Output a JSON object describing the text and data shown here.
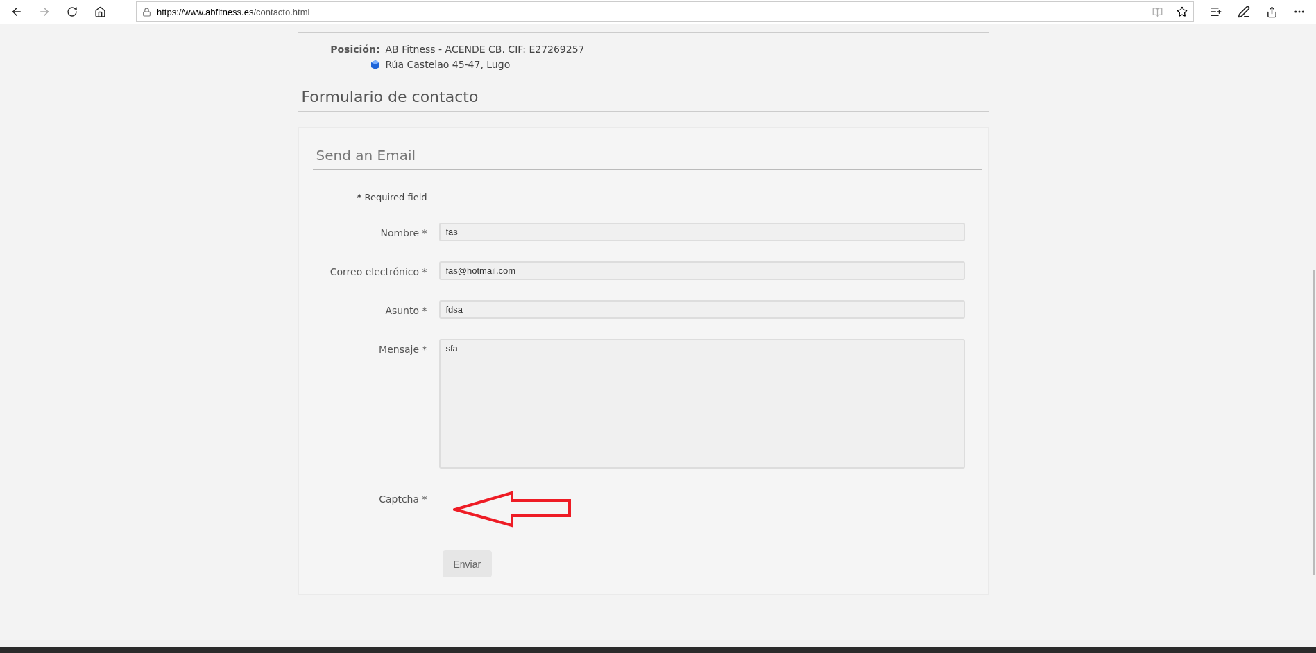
{
  "browser": {
    "url_host": "https://www.abfitness.es",
    "url_path": "/contacto.html"
  },
  "info": {
    "label": "Posición:",
    "value": "AB Fitness - ACENDE CB. CIF: E27269257",
    "address": "Rúa Castelao 45-47, Lugo"
  },
  "section_title": "Formulario de contacto",
  "form": {
    "title": "Send an Email",
    "required_note": {
      "mark": "*",
      "text": "Required field"
    },
    "fields": [
      {
        "kind": "input",
        "label": "Nombre *",
        "value": "fas"
      },
      {
        "kind": "input",
        "label": "Correo electrónico *",
        "value": "fas@hotmail.com"
      },
      {
        "kind": "input",
        "label": "Asunto *",
        "value": "fdsa"
      },
      {
        "kind": "textarea",
        "label": "Mensaje *",
        "value": "sfa"
      },
      {
        "kind": "captcha",
        "label": "Captcha *"
      }
    ],
    "submit": "Enviar"
  }
}
